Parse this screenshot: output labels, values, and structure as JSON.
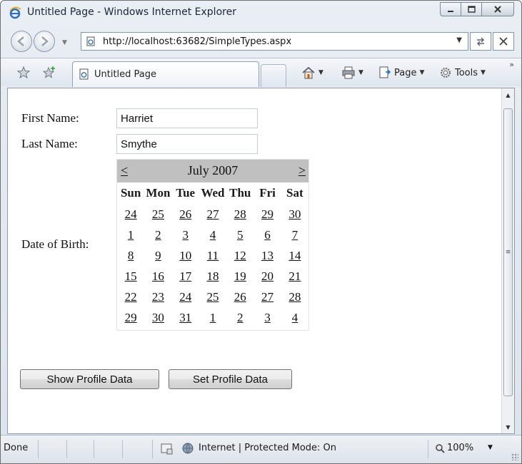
{
  "window": {
    "title": "Untitled Page - Windows Internet Explorer",
    "controls": {
      "minimize": "minimize-icon",
      "maximize": "maximize-icon",
      "close": "close-icon"
    }
  },
  "address_bar": {
    "url": "http://localhost:63682/SimpleTypes.aspx"
  },
  "tab": {
    "label": "Untitled Page"
  },
  "command_bar": {
    "page_label": "Page",
    "tools_label": "Tools",
    "more": "»"
  },
  "form": {
    "first_name_label": "First Name:",
    "first_name_value": "Harriet",
    "last_name_label": "Last Name:",
    "last_name_value": "Smythe",
    "dob_label": "Date of Birth:"
  },
  "calendar": {
    "prev": "<",
    "next": ">",
    "title": "July 2007",
    "day_headers": [
      "Sun",
      "Mon",
      "Tue",
      "Wed",
      "Thu",
      "Fri",
      "Sat"
    ],
    "weeks": [
      [
        "24",
        "25",
        "26",
        "27",
        "28",
        "29",
        "30"
      ],
      [
        "1",
        "2",
        "3",
        "4",
        "5",
        "6",
        "7"
      ],
      [
        "8",
        "9",
        "10",
        "11",
        "12",
        "13",
        "14"
      ],
      [
        "15",
        "16",
        "17",
        "18",
        "19",
        "20",
        "21"
      ],
      [
        "22",
        "23",
        "24",
        "25",
        "26",
        "27",
        "28"
      ],
      [
        "29",
        "30",
        "31",
        "1",
        "2",
        "3",
        "4"
      ]
    ]
  },
  "buttons": {
    "show_profile": "Show Profile Data",
    "set_profile": "Set Profile Data"
  },
  "status_bar": {
    "status": "Done",
    "zone": "Internet | Protected Mode: On",
    "zoom": "100%"
  }
}
